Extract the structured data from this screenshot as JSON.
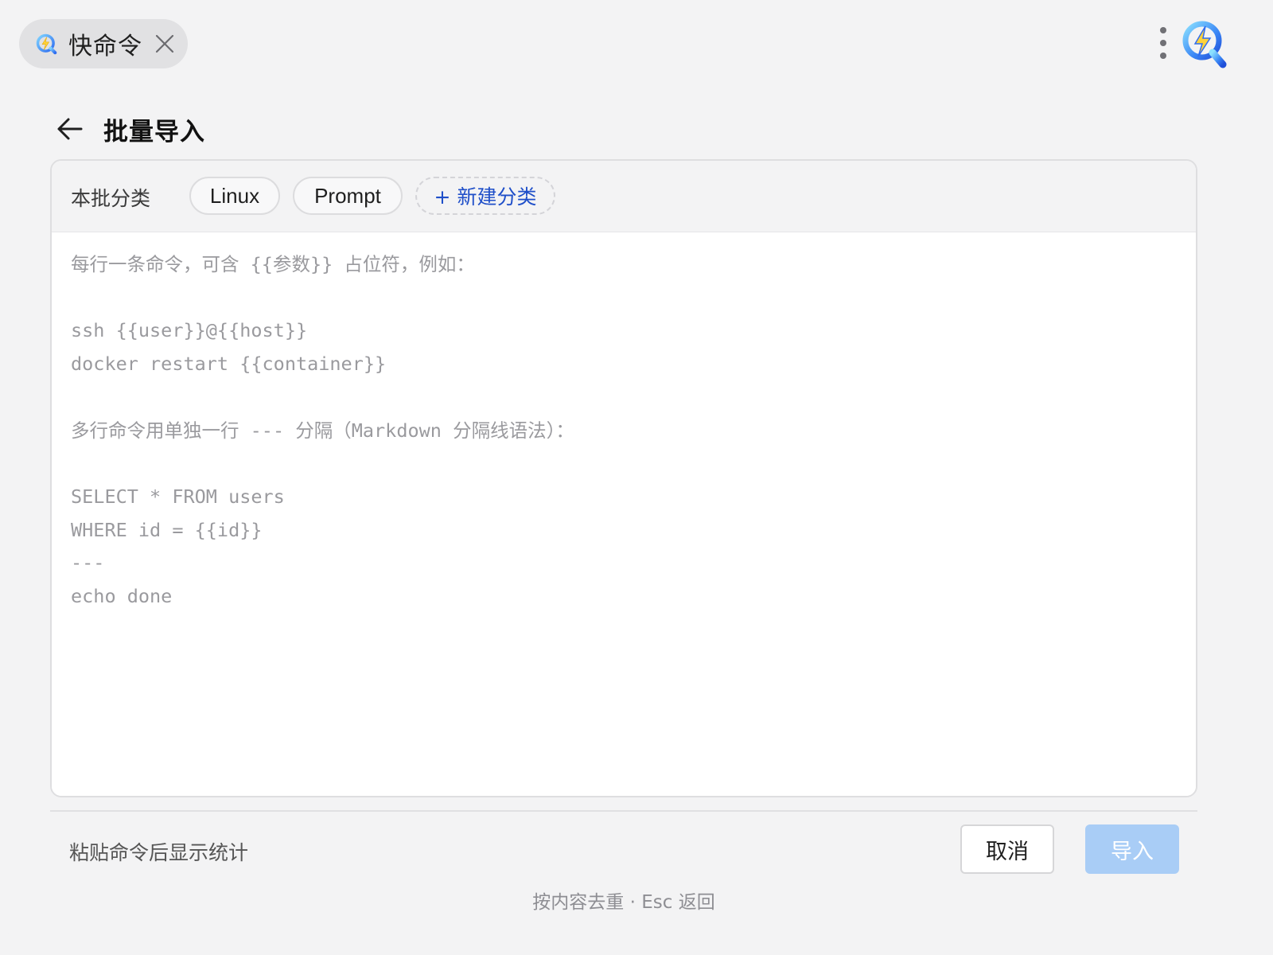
{
  "app": {
    "tab_label": "快命令",
    "accent_color": "#1f4fc9",
    "logo_icon": "lightning-q-logo"
  },
  "header": {
    "title": "批量导入"
  },
  "category_bar": {
    "label": "本批分类",
    "chips": [
      "Linux",
      "Prompt"
    ],
    "new_category_label": "+ 新建分类"
  },
  "editor": {
    "value": "",
    "placeholder": "每行一条命令，可含 {{参数}} 占位符，例如：\n\nssh {{user}}@{{host}}\ndocker restart {{container}}\n\n多行命令用单独一行 --- 分隔（Markdown 分隔线语法）：\n\nSELECT * FROM users\nWHERE id = {{id}}\n---\necho done"
  },
  "footer": {
    "stats_text": "粘贴命令后显示统计",
    "cancel_label": "取消",
    "import_label": "导入",
    "import_color": "#a9cdf6",
    "hint": "按内容去重 · Esc 返回"
  }
}
